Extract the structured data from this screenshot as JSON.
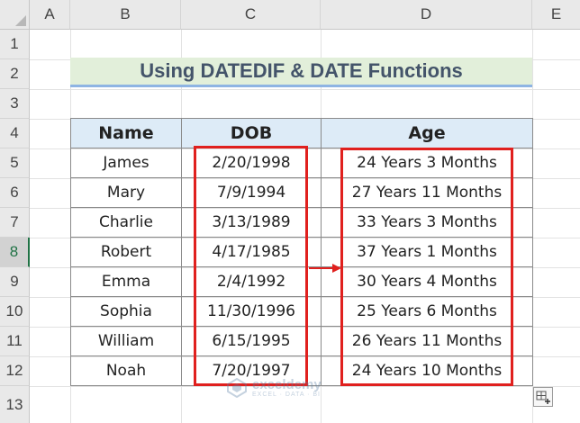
{
  "columns": [
    "A",
    "B",
    "C",
    "D",
    "E"
  ],
  "rows": [
    "1",
    "2",
    "3",
    "4",
    "5",
    "6",
    "7",
    "8",
    "9",
    "10",
    "11",
    "12",
    "13"
  ],
  "selected_row": "8",
  "title": "Using DATEDIF & DATE Functions",
  "table": {
    "headers": [
      "Name",
      "DOB",
      "Age"
    ],
    "rows": [
      [
        "James",
        "2/20/1998",
        "24 Years 3 Months"
      ],
      [
        "Mary",
        "7/9/1994",
        "27 Years 11 Months"
      ],
      [
        "Charlie",
        "3/13/1989",
        "33 Years 3 Months"
      ],
      [
        "Robert",
        "4/17/1985",
        "37 Years 1 Months"
      ],
      [
        "Emma",
        "2/4/1992",
        "30 Years 4 Months"
      ],
      [
        "Sophia",
        "11/30/1996",
        "25 Years 6 Months"
      ],
      [
        "William",
        "6/15/1995",
        "26 Years 11 Months"
      ],
      [
        "Noah",
        "7/20/1997",
        "24 Years 10 Months"
      ]
    ]
  },
  "watermark": {
    "title": "exceldemy",
    "subtitle": "EXCEL · DATA · BI"
  },
  "icons": {
    "arrow": "right-arrow-icon",
    "quick_analysis": "quick-analysis-icon",
    "logo": "exceldemy-logo-icon"
  },
  "colors": {
    "title_bg": "#e2efda",
    "header_bg": "#ddebf7",
    "highlight": "#e0201e",
    "selected_row": "#217346"
  }
}
